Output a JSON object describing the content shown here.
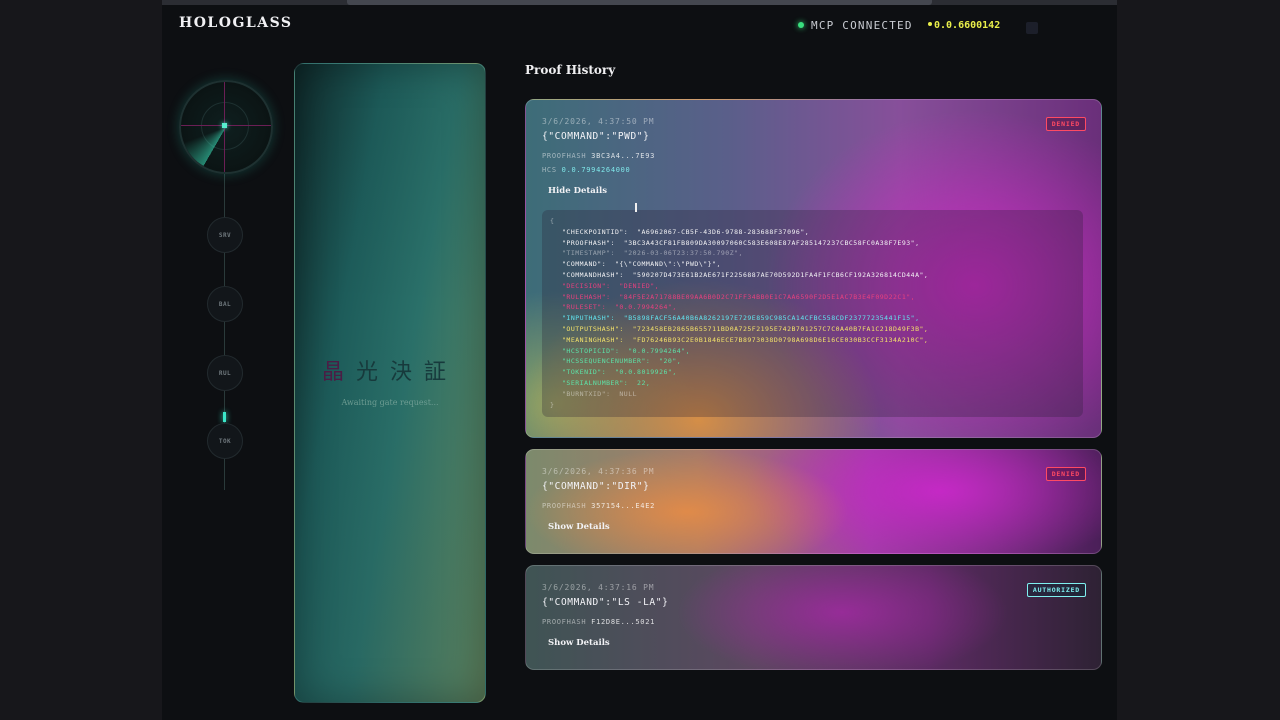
{
  "app": {
    "brand": "HOLOGLASS",
    "status": "MCP CONNECTED",
    "account": "0.0.6600142"
  },
  "rail": {
    "nodes": [
      "SRV",
      "BAL",
      "RUL",
      "TOK"
    ]
  },
  "waiting_panel": {
    "kanji": [
      "晶",
      "光",
      "決",
      "証"
    ],
    "message": "Awaiting gate request..."
  },
  "proof_history": {
    "title": "Proof History",
    "cards": [
      {
        "time": "3/6/2026, 4:37:50 PM",
        "command": "{\"COMMAND\":\"PWD\"}",
        "proofhash_label": "PROOFHASH",
        "proofhash": "3BC3A4...7E93",
        "hcs_label": "HCS",
        "hcs": "0.0.7994264000",
        "toggle": "Hide Details",
        "badge": "DENIED",
        "details": {
          "open": "{",
          "close": "}",
          "rows": [
            {
              "key": "\"CHECKPOINTID\":",
              "value": "\"A6962067-CB5F-43D6-9788-283688F37096\",",
              "color": "white"
            },
            {
              "key": "\"PROOFHASH\":",
              "value": "\"3BC3A43CF81FB809DA30097060C583E608E87AF285147237CBC58FC0A38F7E93\",",
              "color": "white"
            },
            {
              "key": "\"TIMESTAMP\":",
              "value": "\"2026-03-06T23:37:50.790Z\",",
              "color": "dim"
            },
            {
              "key": "\"COMMAND\":",
              "value": "\"{\\\"COMMAND\\\":\\\"PWD\\\"}\",",
              "color": "white"
            },
            {
              "key": "\"COMMANDHASH\":",
              "value": "\"590207D473E61B2AE671F2256887AE70D592D1FA4F1FCB6CF192A326814CD44A\",",
              "color": "white"
            },
            {
              "key": "\"DECISION\":",
              "value": "\"DENIED\",",
              "color": "red"
            },
            {
              "key": "\"RULEHASH\":",
              "value": "\"84F5E2A71788BE09AA6B0D2C71FF34BB0E1C7AA6590F2D5E1AC7B3E4F09D22C1\",",
              "color": "red"
            },
            {
              "key": "\"RULESET\":",
              "value": "\"0.0.7994264\",",
              "color": "red"
            },
            {
              "key": "\"INPUTHASH\":",
              "value": "\"B5898FACF56A40B6A8262197E729E859C985CA14CFBC558CDF23777235441F15\",",
              "color": "cyan"
            },
            {
              "key": "\"OUTPUTSHASH\":",
              "value": "\"723458EB2865B655711BD0A725F2195E742B701257C7C0A40B7FA1C218D49F3B\",",
              "color": "yellow"
            },
            {
              "key": "\"MEANINGHASH\":",
              "value": "\"FD76246B93C2E0B1846ECE7B8973038D0798A698D6E16CE030B3CCF3134A210C\",",
              "color": "yellow"
            },
            {
              "key": "\"HCSTOPICID\":",
              "value": "\"0.0.7994264\",",
              "color": "green"
            },
            {
              "key": "\"HCSSEQUENCENUMBER\":",
              "value": "\"20\",",
              "color": "green"
            },
            {
              "key": "\"TOKENID\":",
              "value": "\"0.0.8019926\",",
              "color": "green"
            },
            {
              "key": "\"SERIALNUMBER\":",
              "value": "22,",
              "color": "green"
            },
            {
              "key": "\"BURNTXID\":",
              "value": "NULL",
              "color": "dim"
            }
          ]
        }
      },
      {
        "time": "3/6/2026, 4:37:36 PM",
        "command": "{\"COMMAND\":\"DIR\"}",
        "proofhash_label": "PROOFHASH",
        "proofhash": "357154...E4E2",
        "toggle": "Show Details",
        "badge": "DENIED"
      },
      {
        "time": "3/6/2026, 4:37:16 PM",
        "command": "{\"COMMAND\":\"LS -LA\"}",
        "proofhash_label": "PROOFHASH",
        "proofhash": "F12D8E...5021",
        "toggle": "Show Details",
        "badge": "AUTHORIZED"
      }
    ]
  },
  "colors": {
    "accent_teal": "#3be7c9",
    "denied": "#ff4a63",
    "authorized": "#7ff0f0",
    "account_yellow": "#e9ef4a",
    "connected_green": "#39e07f"
  },
  "icons": [
    "radar-icon"
  ]
}
